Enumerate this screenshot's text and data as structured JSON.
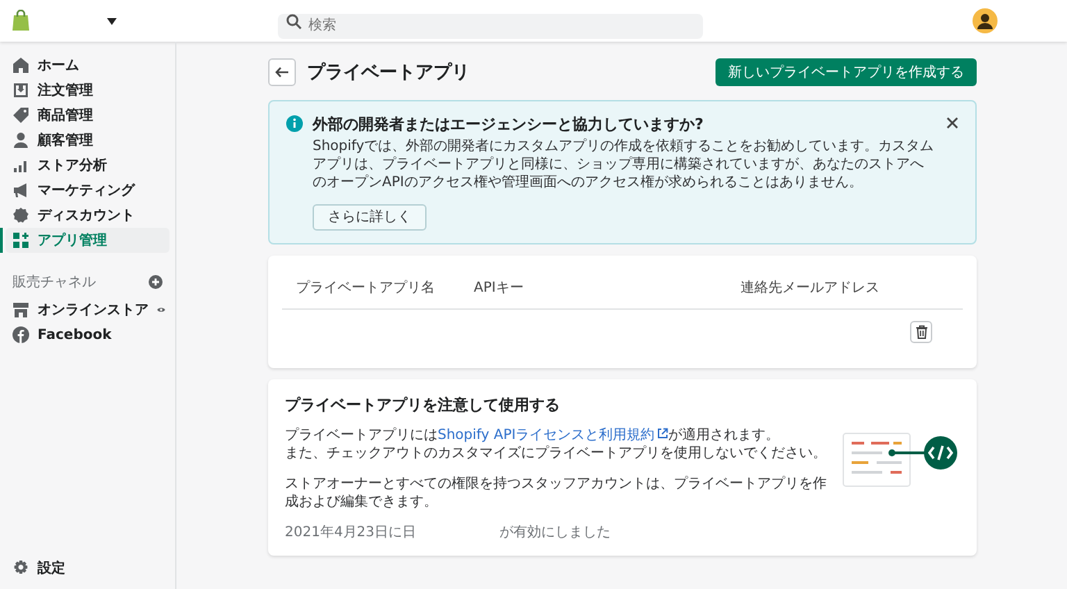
{
  "top_bar": {
    "search": {
      "placeholder": "検索"
    }
  },
  "sidebar": {
    "items": [
      {
        "label": "ホーム",
        "selected": false
      },
      {
        "label": "注文管理",
        "selected": false
      },
      {
        "label": "商品管理",
        "selected": false
      },
      {
        "label": "顧客管理",
        "selected": false
      },
      {
        "label": "ストア分析",
        "selected": false
      },
      {
        "label": "マーケティング",
        "selected": false
      },
      {
        "label": "ディスカウント",
        "selected": false
      },
      {
        "label": "アプリ管理",
        "selected": true
      }
    ],
    "channels_heading": "販売チャネル",
    "channels": [
      {
        "label": "オンラインストア"
      },
      {
        "label": "Facebook"
      }
    ],
    "settings": "設定"
  },
  "page": {
    "title": "プライベートアプリ",
    "primary_button": "新しいプライベートアプリを作成する"
  },
  "banner": {
    "title": "外部の開発者またはエージェンシーと協力していますか?",
    "body": "Shopifyでは、外部の開発者にカスタムアプリの作成を依頼することをお勧めしています。カスタムアプリは、プライベートアプリと同様に、ショップ専用に構築されていますが、あなたのストアへのオープンAPIのアクセス権や管理画面へのアクセス権が求められることはありません。",
    "button": "さらに詳しく"
  },
  "table": {
    "columns": [
      "プライベートアプリ名",
      "APIキー",
      "連絡先メールアドレス"
    ]
  },
  "notice": {
    "title": "プライベートアプリを注意して使用する",
    "line_1": {
      "before": "プライベートアプリには",
      "link": "Shopify APIライセンスと利用規約",
      "after": "が適用されます。"
    },
    "line_2": "また、チェックアウトのカスタマイズにプライベートアプリを使用しないでください。",
    "paragraph_2": "ストアオーナーとすべての権限を持つスタッフアカウントは、プライベートアプリを作成および編集できます。",
    "enabled_note": [
      "2021年4月23日に日",
      "が有効にしました"
    ]
  }
}
